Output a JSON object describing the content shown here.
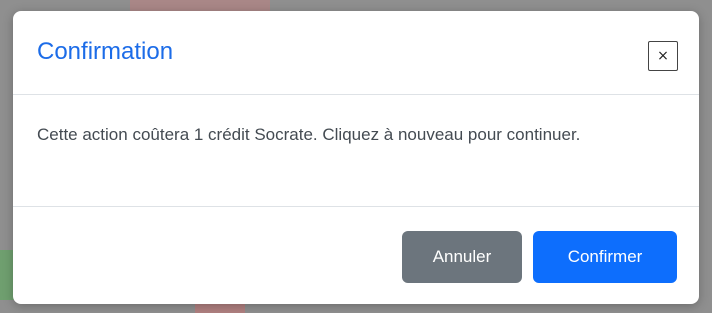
{
  "modal": {
    "title": "Confirmation",
    "close_label": "×",
    "message": "Cette action coûtera 1 crédit Socrate. Cliquez à nouveau pour continuer.",
    "cancel_label": "Annuler",
    "confirm_label": "Confirmer"
  },
  "colors": {
    "title": "#1c6ce8",
    "cancel_button": "#6c757d",
    "confirm_button": "#0d6efd",
    "backdrop": "#8f8f8f"
  }
}
